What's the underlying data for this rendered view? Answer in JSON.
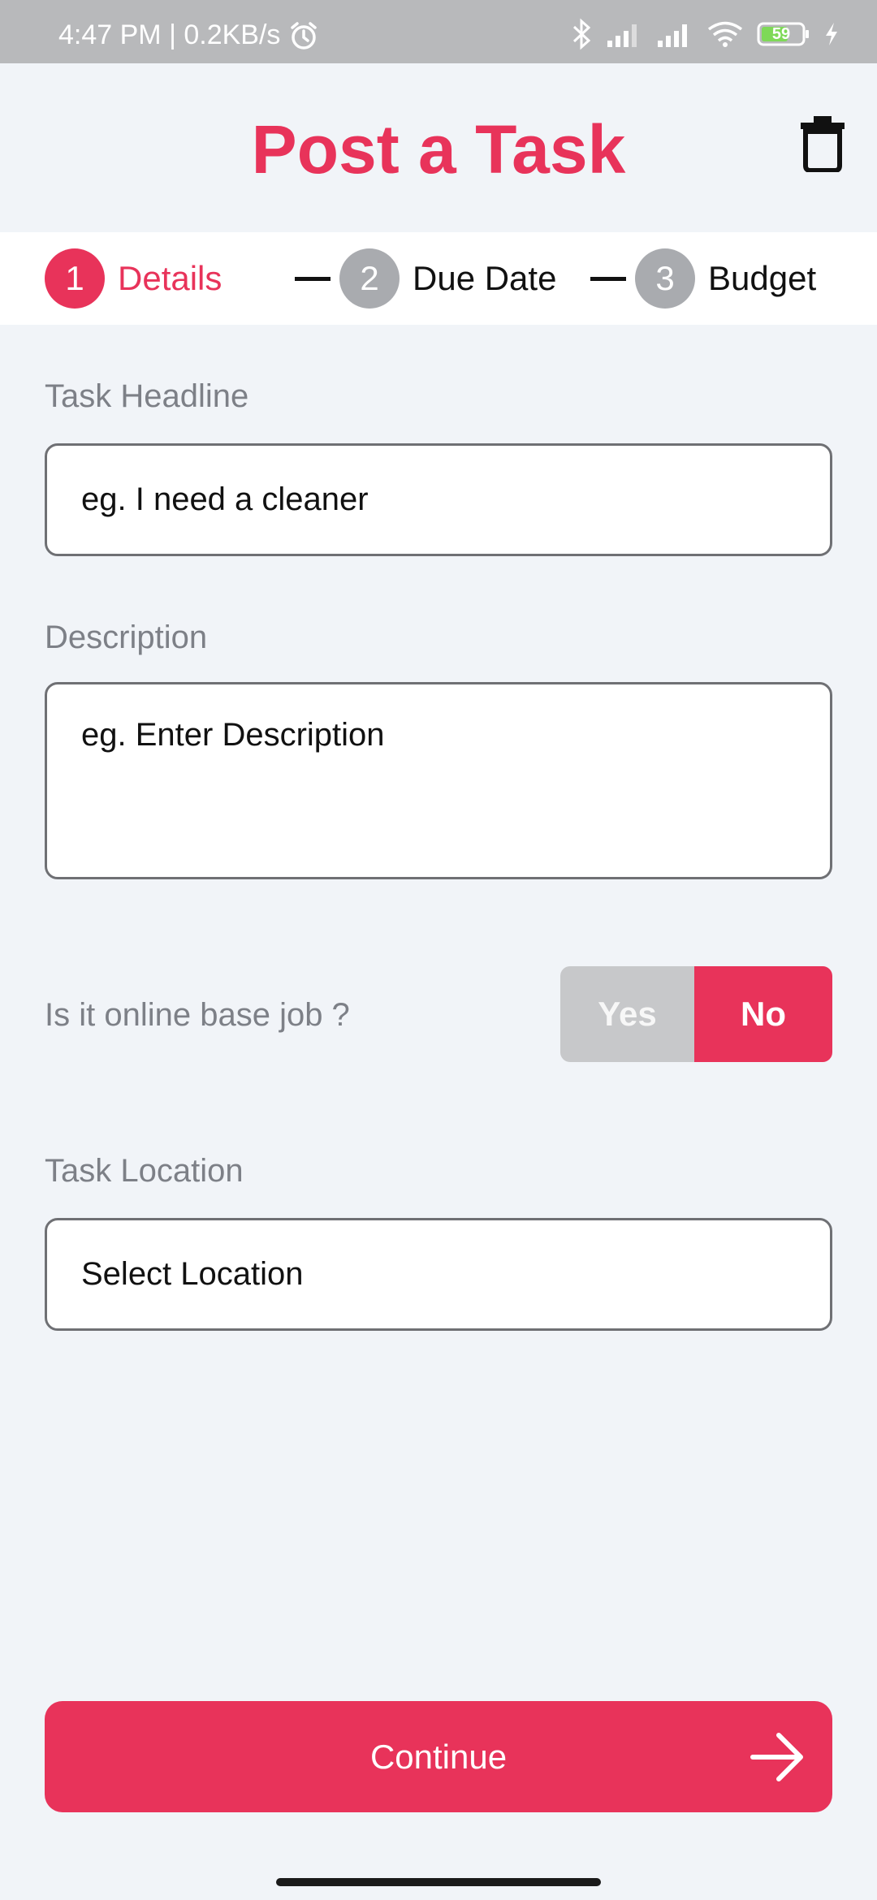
{
  "status_bar": {
    "time_speed": "4:47 PM | 0.2KB/s",
    "battery": "59"
  },
  "header": {
    "title": "Post a Task"
  },
  "stepper": {
    "steps": [
      {
        "number": "1",
        "label": "Details",
        "state": "active"
      },
      {
        "number": "2",
        "label": "Due Date",
        "state": "inactive"
      },
      {
        "number": "3",
        "label": "Budget",
        "state": "inactive"
      }
    ]
  },
  "form": {
    "headline": {
      "label": "Task Headline",
      "placeholder": "eg. I need a cleaner"
    },
    "description": {
      "label": "Description",
      "placeholder": "eg. Enter Description"
    },
    "online_job": {
      "question": "Is it online base job ?",
      "yes_label": "Yes",
      "no_label": "No",
      "selected": "No"
    },
    "location": {
      "label": "Task Location",
      "placeholder": "Select Location"
    }
  },
  "footer": {
    "continue_label": "Continue"
  },
  "colors": {
    "accent": "#e8335a",
    "background": "#f1f4f8",
    "label_gray": "#7d8087",
    "inactive_step": "#a9abaf"
  }
}
